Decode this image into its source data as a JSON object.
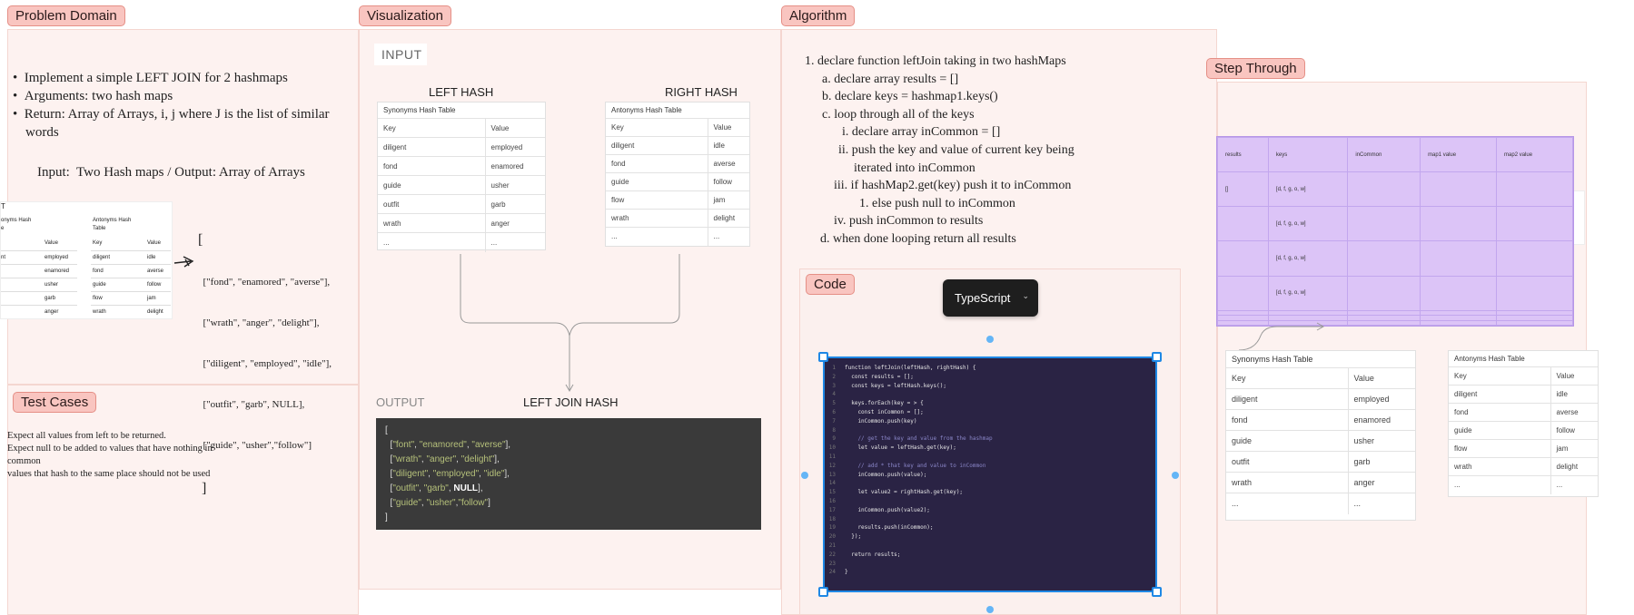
{
  "sections": {
    "problem": "Problem Domain",
    "visualization": "Visualization",
    "algorithm": "Algorithm",
    "step_through": "Step Through",
    "test_cases": "Test Cases",
    "code": "Code"
  },
  "problem": {
    "bullets": [
      "Implement a simple LEFT JOIN for 2 hashmaps",
      "Arguments: two hash maps",
      "Return: Array of Arrays, i, j where J is the list of similar",
      "words"
    ],
    "io": "Input:  Two Hash maps / Output: Array of Arrays",
    "mini_left": {
      "title_lines": [
        "onyms Hash",
        "e"
      ],
      "header": [
        "",
        "Value"
      ],
      "rows": [
        [
          "nt",
          "employed"
        ],
        [
          "",
          "enamored"
        ],
        [
          "",
          "usher"
        ],
        [
          "",
          "garb"
        ],
        [
          "",
          "anger"
        ]
      ]
    },
    "mini_right": {
      "title_lines": [
        "Antonyms Hash",
        "Table"
      ],
      "header": [
        "Key",
        "Value"
      ],
      "rows": [
        [
          "diligent",
          "idle"
        ],
        [
          "fond",
          "averse"
        ],
        [
          "guide",
          "follow"
        ],
        [
          "flow",
          "jam"
        ],
        [
          "wrath",
          "delight"
        ]
      ]
    },
    "cut_label": "T",
    "output_lines": [
      "[",
      "  [\"fond\", \"enamored\", \"averse\"],",
      "  [\"wrath\", \"anger\", \"delight\"],",
      "  [\"diligent\", \"employed\", \"idle\"],",
      "  [\"outfit\", \"garb\", NULL],",
      "  [\"guide\", \"usher\",\"follow\"]",
      " ]"
    ]
  },
  "test_cases": {
    "lines": [
      "Expect all values from left to be returned.",
      "Expect null to be added to values that have nothing in",
      "common",
      "values that hash to the same place should not be used"
    ]
  },
  "visualization": {
    "input_label": "INPUT",
    "left_hash": "LEFT HASH",
    "right_hash": "RIGHT HASH",
    "output_label": "OUTPUT",
    "left_join_hash": "LEFT JOIN HASH",
    "synonyms": {
      "title": "Synonyms Hash Table",
      "header": [
        "Key",
        "Value"
      ],
      "rows": [
        [
          "diligent",
          "employed"
        ],
        [
          "fond",
          "enamored"
        ],
        [
          "guide",
          "usher"
        ],
        [
          "outfit",
          "garb"
        ],
        [
          "wrath",
          "anger"
        ],
        [
          "...",
          "..."
        ]
      ]
    },
    "antonyms": {
      "title": "Antonyms Hash Table",
      "header": [
        "Key",
        "Value"
      ],
      "rows": [
        [
          "diligent",
          "idle"
        ],
        [
          "fond",
          "averse"
        ],
        [
          "guide",
          "follow"
        ],
        [
          "flow",
          "jam"
        ],
        [
          "wrath",
          "delight"
        ],
        [
          "...",
          "..."
        ]
      ]
    },
    "output": {
      "open": "[",
      "close": "]",
      "rows": [
        {
          "a": "\"font\"",
          "b": "\"enamored\"",
          "c": "\"averse\""
        },
        {
          "a": "\"wrath\"",
          "b": "\"anger\"",
          "c": "\"delight\""
        },
        {
          "a": "\"diligent\"",
          "b": "\"employed\"",
          "c": "\"idle\""
        },
        {
          "a": "\"outfit\"",
          "b": "\"garb\"",
          "c": "NULL"
        },
        {
          "a": "\"guide\"",
          "b": "\"usher\"",
          "c": "\"follow\""
        }
      ]
    }
  },
  "algorithm": {
    "steps": [
      {
        "marker": "1.",
        "text": "declare function leftJoin taking in two hashMaps"
      },
      {
        "marker": "a.",
        "text": "declare array results = []"
      },
      {
        "marker": "b.",
        "text": "declare keys = hashmap1.keys()"
      },
      {
        "marker": "c.",
        "text": "loop through all of the keys"
      },
      {
        "marker": "i.",
        "text": "declare array inCommon = []"
      },
      {
        "marker": "ii.",
        "text": "push the key and value of current key being"
      },
      {
        "marker": "",
        "text": "iterated into inCommon"
      },
      {
        "marker": "iii.",
        "text": "if hashMap2.get(key) push it to inCommon"
      },
      {
        "marker": "1.",
        "text": "else push null to inCommon"
      },
      {
        "marker": "iv.",
        "text": "push inCommon to results"
      },
      {
        "marker": "d.",
        "text": "when done looping return all results"
      }
    ]
  },
  "code": {
    "language": "TypeScript",
    "lines": [
      "function leftJoin(leftHash, rightHash) {",
      "  const results = [];",
      "  const keys = leftHash.keys();",
      "",
      "  keys.forEach(key = > {",
      "    const inCommon = [];",
      "    inCommon.push(key)",
      "",
      "    // get the key and value from the hashmap",
      "    let value = leftHash.get(key);",
      "",
      "    // add * that key and value to inCommon",
      "    inCommon.push(value);",
      "",
      "    let value2 = rightHash.get(key);",
      "",
      "    inCommon.push(value2);",
      "",
      "    results.push(inCommon);",
      "  });",
      "",
      "  return results;",
      "",
      "}"
    ]
  },
  "step_through": {
    "grid_header": [
      "results",
      "keys",
      "inCommon",
      "map1 value",
      "map2 value"
    ],
    "grid_rows": [
      [
        "[]",
        "[d, f, g, o, w]",
        "",
        "",
        ""
      ],
      [
        "",
        "[d, f, g, o, w]",
        "",
        "",
        ""
      ],
      [
        "",
        "[d, f, g, o, w]",
        "",
        "",
        ""
      ],
      [
        "",
        "[d, f, g, o, w]",
        "",
        "",
        ""
      ],
      [
        "",
        "",
        "",
        "",
        ""
      ],
      [
        "",
        "",
        "",
        "",
        ""
      ],
      [
        "",
        "",
        "",
        "",
        ""
      ]
    ],
    "synonyms": {
      "title": "Synonyms Hash Table",
      "header": [
        "Key",
        "Value"
      ],
      "rows": [
        [
          "diligent",
          "employed"
        ],
        [
          "fond",
          "enamored"
        ],
        [
          "guide",
          "usher"
        ],
        [
          "outfit",
          "garb"
        ],
        [
          "wrath",
          "anger"
        ],
        [
          "...",
          "..."
        ]
      ]
    },
    "antonyms": {
      "title": "Antonyms Hash Table",
      "header": [
        "Key",
        "Value"
      ],
      "rows": [
        [
          "diligent",
          "idle"
        ],
        [
          "fond",
          "averse"
        ],
        [
          "guide",
          "follow"
        ],
        [
          "flow",
          "jam"
        ],
        [
          "wrath",
          "delight"
        ],
        [
          "...",
          "..."
        ]
      ]
    }
  }
}
